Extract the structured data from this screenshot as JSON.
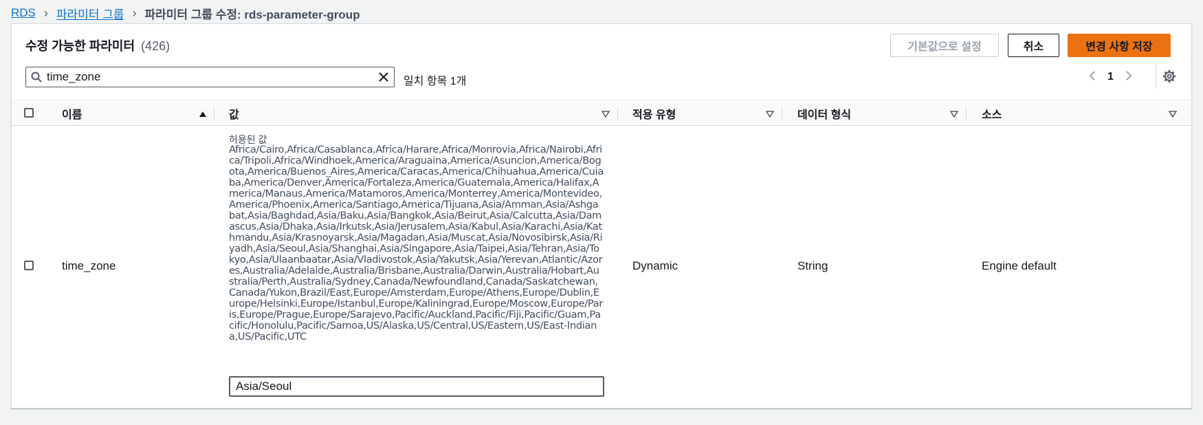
{
  "breadcrumb": {
    "items": [
      "RDS",
      "파라미터 그룹"
    ],
    "current": "파라미터 그룹 수정: rds-parameter-group"
  },
  "panel": {
    "title": "수정 가능한 파라미터",
    "count": "(426)"
  },
  "actions": {
    "set_default": "기본값으로 설정",
    "cancel": "취소",
    "save": "변경 사항 저장"
  },
  "search": {
    "value": "time_zone",
    "match_text": "일치 항목 1개"
  },
  "pagination": {
    "current_page": "1"
  },
  "table": {
    "columns": [
      "이름",
      "값",
      "적용 유형",
      "데이터 형식",
      "소스"
    ],
    "rows": [
      {
        "name": "time_zone",
        "allowed_label": "허용된 값",
        "allowed_values": "Africa/Cairo,Africa/Casablanca,Africa/Harare,Africa/Monrovia,Africa/Nairobi,Africa/Tripoli,Africa/Windhoek,America/Araguaina,America/Asuncion,America/Bogota,America/Buenos_Aires,America/Caracas,America/Chihuahua,America/Cuiaba,America/Denver,America/Fortaleza,America/Guatemala,America/Halifax,America/Manaus,America/Matamoros,America/Monterrey,America/Montevideo,America/Phoenix,America/Santiago,America/Tijuana,Asia/Amman,Asia/Ashgabat,Asia/Baghdad,Asia/Baku,Asia/Bangkok,Asia/Beirut,Asia/Calcutta,Asia/Damascus,Asia/Dhaka,Asia/Irkutsk,Asia/Jerusalem,Asia/Kabul,Asia/Karachi,Asia/Kathmandu,Asia/Krasnoyarsk,Asia/Magadan,Asia/Muscat,Asia/Novosibirsk,Asia/Riyadh,Asia/Seoul,Asia/Shanghai,Asia/Singapore,Asia/Taipei,Asia/Tehran,Asia/Tokyo,Asia/Ulaanbaatar,Asia/Vladivostok,Asia/Yakutsk,Asia/Yerevan,Atlantic/Azores,Australia/Adelaide,Australia/Brisbane,Australia/Darwin,Australia/Hobart,Australia/Perth,Australia/Sydney,Canada/Newfoundland,Canada/Saskatchewan,Canada/Yukon,Brazil/East,Europe/Amsterdam,Europe/Athens,Europe/Dublin,Europe/Helsinki,Europe/Istanbul,Europe/Kaliningrad,Europe/Moscow,Europe/Paris,Europe/Prague,Europe/Sarajevo,Pacific/Auckland,Pacific/Fiji,Pacific/Guam,Pacific/Honolulu,Pacific/Samoa,US/Alaska,US/Central,US/Eastern,US/East-Indiana,US/Pacific,UTC",
        "value": "Asia/Seoul",
        "apply_type": "Dynamic",
        "data_type": "String",
        "source": "Engine default"
      }
    ]
  },
  "icons": {
    "breadcrumb_separator": "chevron-right-icon",
    "search": "search-icon",
    "clear": "close-icon",
    "prev": "chevron-left-icon",
    "next": "chevron-right-icon",
    "settings": "gear-icon",
    "sort_asc": "caret-up-icon",
    "sort_none": "caret-down-outline-icon"
  },
  "colors": {
    "link": "#0972d3",
    "primary": "#ec7211",
    "border": "#d5dbdb"
  }
}
